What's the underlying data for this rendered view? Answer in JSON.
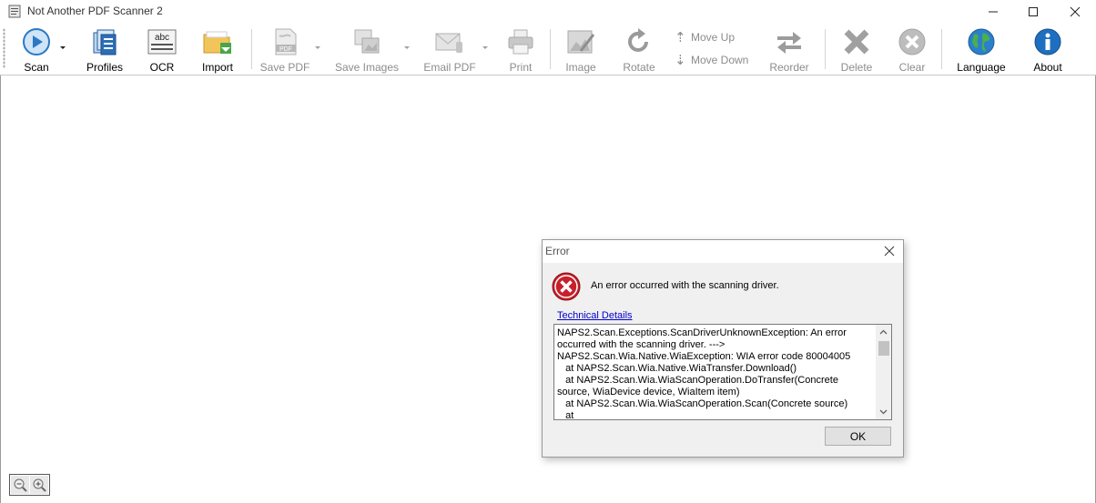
{
  "window": {
    "title": "Not Another PDF Scanner 2"
  },
  "toolbar": {
    "scan": "Scan",
    "profiles": "Profiles",
    "ocr": "OCR",
    "ocr_icon_text": "abc",
    "import": "Import",
    "save_pdf": "Save PDF",
    "save_images": "Save Images",
    "email_pdf": "Email PDF",
    "print": "Print",
    "image": "Image",
    "rotate": "Rotate",
    "move_up": "Move Up",
    "move_down": "Move Down",
    "reorder": "Reorder",
    "delete": "Delete",
    "clear": "Clear",
    "language": "Language",
    "about": "About"
  },
  "dialog": {
    "title": "Error",
    "message": "An error occurred with the scanning driver.",
    "link": "Technical Details",
    "details": "NAPS2.Scan.Exceptions.ScanDriverUnknownException: An error occurred with the scanning driver. --->\nNAPS2.Scan.Wia.Native.WiaException: WIA error code 80004005\n   at NAPS2.Scan.Wia.Native.WiaTransfer.Download()\n   at NAPS2.Scan.Wia.WiaScanOperation.DoTransfer(Concrete source, WiaDevice device, WiaItem item)\n   at NAPS2.Scan.Wia.WiaScanOperation.Scan(Concrete source)\n   at",
    "ok": "OK"
  },
  "colors": {
    "accent_blue": "#1e6fc0",
    "error_red": "#c8202b",
    "disabled_gray": "#a8a8a8"
  },
  "icons": [
    "scan-icon",
    "profiles-icon",
    "ocr-icon",
    "folder-icon",
    "pdf-icon",
    "images-icon",
    "email-icon",
    "printer-icon",
    "image-edit-icon",
    "rotate-icon",
    "arrow-up-icon",
    "arrow-down-icon",
    "reorder-icon",
    "delete-icon",
    "clear-icon",
    "globe-icon",
    "info-icon",
    "zoom-out-icon",
    "zoom-in-icon",
    "error-icon",
    "close-icon"
  ]
}
